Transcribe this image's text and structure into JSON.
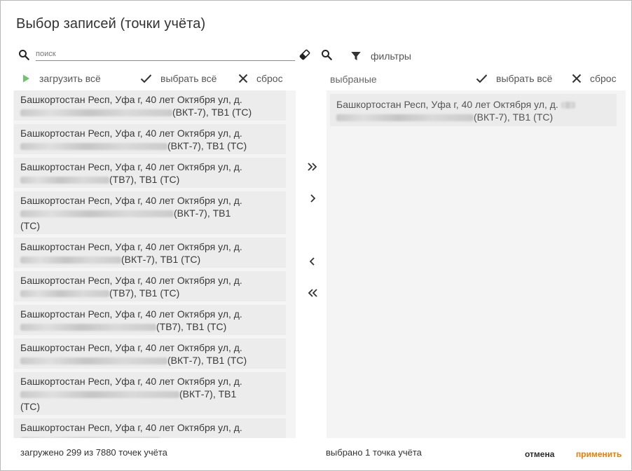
{
  "dialog": {
    "title": "Выбор записей (точки учёта)"
  },
  "search": {
    "placeholder": "поиск",
    "value": ""
  },
  "filters": {
    "label": "фильтры"
  },
  "left_actions": {
    "load_all": "загрузить всё",
    "select_all": "выбрать всё",
    "reset": "сброс"
  },
  "right_header": {
    "label": "выбраные",
    "select_all": "выбрать всё",
    "reset": "сброс"
  },
  "left_list": [
    {
      "line1": "Башкортостан Респ, Уфа г, 40 лет Октября ул, д.",
      "suffix": "(ВКТ-7), ТВ1 (ТС)",
      "line3": ""
    },
    {
      "line1": "Башкортостан Респ, Уфа г, 40 лет Октября ул, д.",
      "suffix": "(ВКТ-7), ТВ1 (ТС)",
      "line3": ""
    },
    {
      "line1": "Башкортостан Респ, Уфа г, 40 лет Октября ул, д.",
      "suffix": "(ТВ7), ТВ1 (ТС)",
      "line3": ""
    },
    {
      "line1": "Башкортостан Респ, Уфа г, 40 лет Октября ул, д.",
      "suffix": "(ВКТ-7), ТВ1",
      "line3": "(ТС)"
    },
    {
      "line1": "Башкортостан Респ, Уфа г, 40 лет Октября ул, д.",
      "suffix": "(ВКТ-7), ТВ1 (ТС)",
      "line3": ""
    },
    {
      "line1": "Башкортостан Респ, Уфа г, 40 лет Октября ул, д.",
      "suffix": "(ТВ7), ТВ1 (ТС)",
      "line3": ""
    },
    {
      "line1": "Башкортостан Респ, Уфа г, 40 лет Октября ул, д.",
      "suffix": "(ТВ7), ТВ1 (ТС)",
      "line3": ""
    },
    {
      "line1": "Башкортостан Респ, Уфа г, 40 лет Октября ул, д.",
      "suffix": "(ВКТ-7), ТВ1 (ТС)",
      "line3": ""
    },
    {
      "line1": "Башкортостан Респ, Уфа г, 40 лет Октября ул, д.",
      "suffix": "(ВКТ-7), ТВ1",
      "line3": "(ТС)"
    },
    {
      "line1": "Башкортостан Респ, Уфа г, 40 лет Октября ул, д.",
      "suffix": "",
      "line3": ""
    }
  ],
  "right_list": [
    {
      "line1": "Башкортостан Респ, Уфа г, 40 лет Октября ул, д.",
      "suffix": "(ВКТ-7), ТВ1 (ТС)"
    }
  ],
  "transfer_buttons": {
    "move_all_right": "»",
    "move_right": "›",
    "move_left": "‹",
    "move_all_left": "«"
  },
  "footer": {
    "loaded_status": "загружено 299 из 7880 точек учёта",
    "selected_status": "выбрано 1 точка учёта",
    "cancel": "отмена",
    "apply": "применить"
  },
  "colors": {
    "accent": "#f07c00",
    "play_icon": "#6cc46c",
    "panel_bg": "#f4f4f4",
    "item_bg": "#ececec"
  },
  "icons": {
    "search": "search-icon",
    "clear": "eraser-icon",
    "filter": "filter-icon",
    "load": "play-icon",
    "check": "check-icon",
    "reset": "close-icon"
  }
}
